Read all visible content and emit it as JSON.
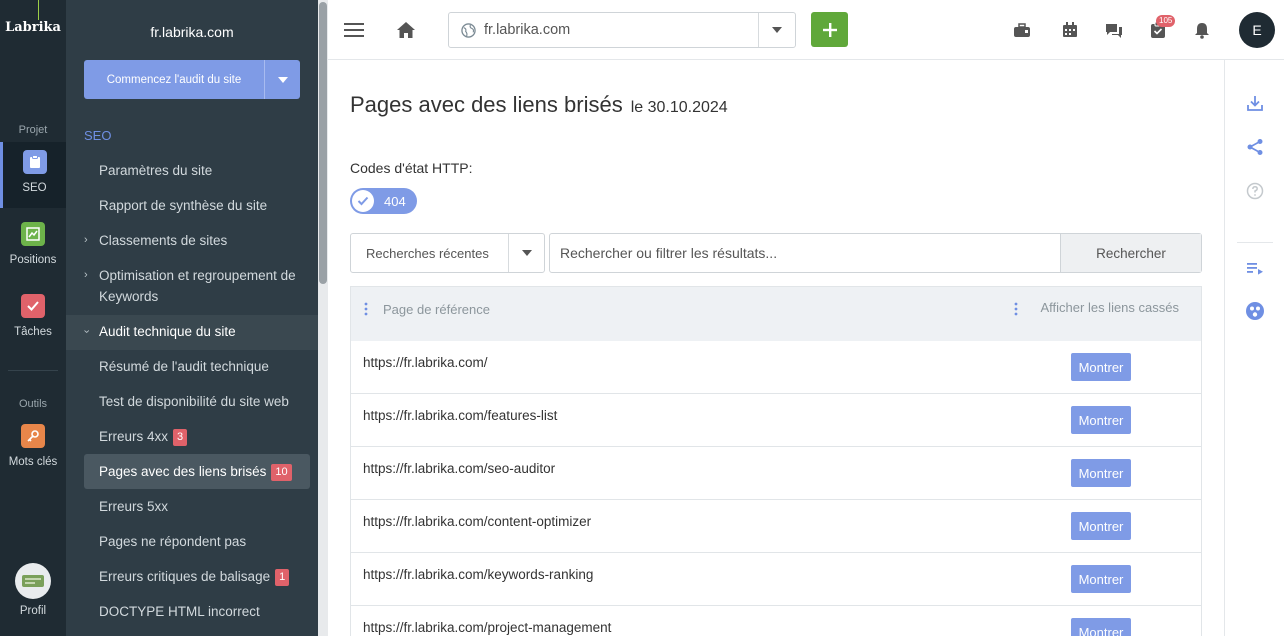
{
  "rail": {
    "logo": "Labrika",
    "group_project": "Projet",
    "seo": "SEO",
    "positions": "Positions",
    "taches": "Tâches",
    "group_tools": "Outils",
    "mots_cles": "Mots clés",
    "profil": "Profil"
  },
  "sidebar": {
    "site": "fr.labrika.com",
    "audit_button": "Commencez l'audit du site",
    "section": "SEO",
    "items": [
      {
        "label": "Paramètres du site"
      },
      {
        "label": "Rapport de synthèse du site"
      },
      {
        "label": "Classements de sites"
      },
      {
        "label": "Optimisation et regroupement de Keywords"
      },
      {
        "label": "Audit technique du site"
      },
      {
        "label": "Résumé de l'audit technique"
      },
      {
        "label": "Test de disponibilité du site web"
      },
      {
        "label": "Erreurs 4xx",
        "badge": "3"
      },
      {
        "label": "Pages avec des liens brisés",
        "badge": "10"
      },
      {
        "label": "Erreurs 5xx"
      },
      {
        "label": "Pages ne répondent pas"
      },
      {
        "label": "Erreurs critiques de balisage",
        "badge": "1"
      },
      {
        "label": "DOCTYPE HTML incorrect"
      }
    ]
  },
  "topbar": {
    "url": "fr.labrika.com",
    "notification_count": "105",
    "avatar_initial": "E",
    "accent": "#60a83a"
  },
  "main": {
    "title": "Pages avec des liens brisés",
    "date": "le 30.10.2024",
    "codes_label": "Codes d'état HTTP:",
    "code_chip": "404",
    "recent_searches": "Recherches récentes",
    "search_placeholder": "Rechercher ou filtrer les résultats...",
    "search_button": "Rechercher",
    "columns": [
      "Page de référence",
      "Afficher les liens cassés"
    ],
    "rows": [
      {
        "url": "https://fr.labrika.com/",
        "action": "Montrer"
      },
      {
        "url": "https://fr.labrika.com/features-list",
        "action": "Montrer"
      },
      {
        "url": "https://fr.labrika.com/seo-auditor",
        "action": "Montrer"
      },
      {
        "url": "https://fr.labrika.com/content-optimizer",
        "action": "Montrer"
      },
      {
        "url": "https://fr.labrika.com/keywords-ranking",
        "action": "Montrer"
      },
      {
        "url": "https://fr.labrika.com/project-management",
        "action": "Montrer"
      }
    ]
  },
  "colors": {
    "accent_blue": "#7f9be6",
    "badge_red": "#e0626a",
    "sidebar_bg": "#2f3d46",
    "rail_bg": "#1f2b33"
  }
}
